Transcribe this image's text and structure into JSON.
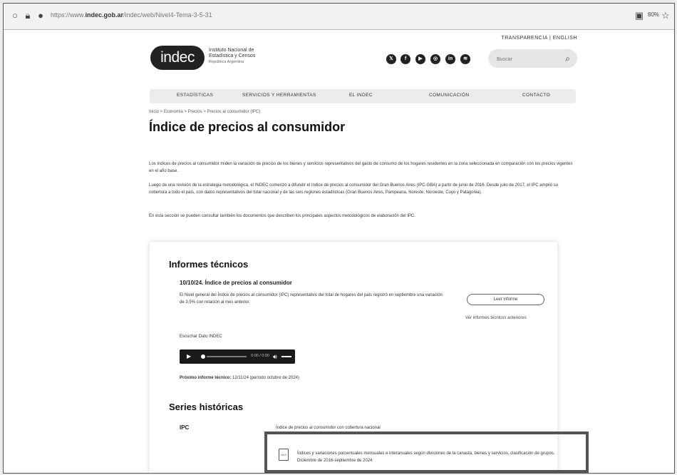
{
  "browser": {
    "url_prefix": "https://www.",
    "url_domain": "indec.gob.ar",
    "url_path": "/indec/web/Nivel4-Tema-3-5-31",
    "zoom": "80%"
  },
  "header": {
    "top_links": "TRANSPARENCIA | ENGLISH",
    "logo": "indec",
    "org_line1": "Instituto Nacional de",
    "org_line2": "Estadística y Censos",
    "org_line3": "República Argentina",
    "social_icons": [
      "x-icon",
      "facebook-icon",
      "youtube-icon",
      "instagram-icon",
      "linkedin-icon",
      "spotify-icon"
    ],
    "search_placeholder": "Buscar"
  },
  "nav": {
    "items": [
      "ESTADÍSTICAS",
      "SERVICIOS Y HERRAMIENTAS",
      "EL INDEC",
      "COMUNICACIÓN",
      "CONTACTO"
    ]
  },
  "breadcrumb": "Inicio > Economía > Precios > Precios al consumidor (IPC)",
  "page_title": "Índice de precios al consumidor",
  "paragraphs": [
    "Los índices de precios al consumidor miden la variación de precios de los bienes y servicios representativos del gasto de consumo de los hogares residentes en la zona seleccionada en comparación con los precios vigentes en el año base.",
    "Luego de una revisión de la estrategia metodológica, el INDEC comenzó a difundir el índice de precios al consumidor del Gran Buenos Aires (IPC-GBA) a partir de junio de 2016. Desde julio de 2017, el IPC amplió su cobertura a todo el país, con datos representativos del total nacional y de las seis regiones estadísticas (Gran Buenos Aires, Pampeana, Noreste, Noroeste, Cuyo y Patagonia).",
    "En esta sección se pueden consultar también los documentos que describen los principales aspectos metodológicos de elaboración del IPC."
  ],
  "informes": {
    "heading": "Informes técnicos",
    "report_title": "10/10/24. Índice de precios al consumidor",
    "report_text": "El Nivel general del Índice de precios al consumidor (IPC) representativo del total de hogares del país registró en septiembre una variación de 3,5% con relación al mes anterior.",
    "read_button": "Leer informe",
    "previous_link": "Ver informes técnicos anteriores",
    "audio_label": "Escuchar Dato INDEC",
    "audio_time": "0:00 / 0:00",
    "next_label": "Próximo informe técnico:",
    "next_text": "12/11/24 (período octubre de 2024)"
  },
  "series": {
    "heading": "Series históricas",
    "row_label": "IPC",
    "row_header": "Índice de precios al consumidor con cobertura nacional",
    "doc_badge": "XLS",
    "doc_text": "Índices y variaciones porcentuales mensuales e interanuales según divisiones de la canasta, bienes y servicios, clasificación de grupos. Diciembre de 2016-septiembre de 2024"
  }
}
